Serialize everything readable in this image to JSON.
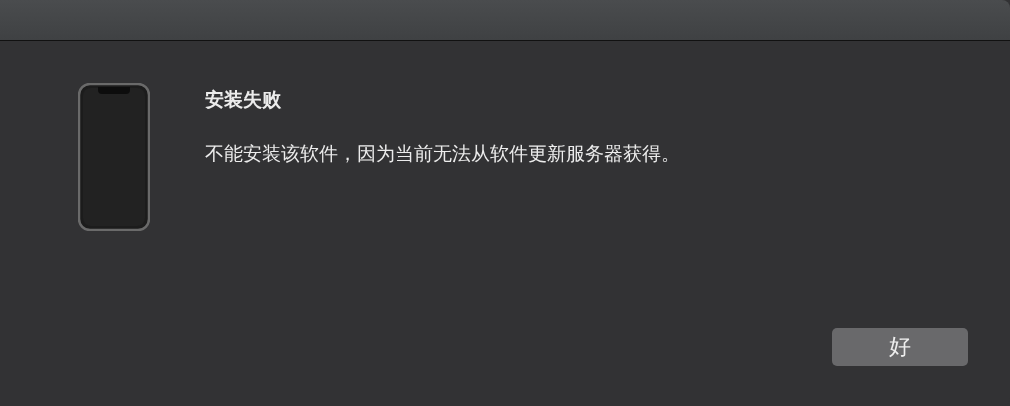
{
  "dialog": {
    "title": "安装失败",
    "message": "不能安装该软件，因为当前无法从软件更新服务器获得。",
    "buttons": [
      "好"
    ]
  }
}
